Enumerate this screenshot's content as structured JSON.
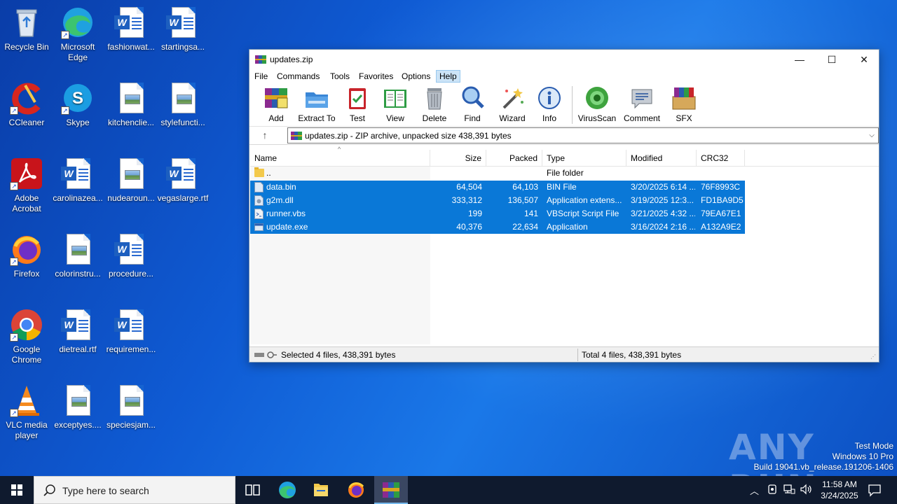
{
  "desktop": {
    "icons": [
      {
        "label": "Recycle Bin"
      },
      {
        "label": "Microsoft Edge"
      },
      {
        "label": "fashionwat..."
      },
      {
        "label": "startingsa..."
      },
      {
        "label": "CCleaner"
      },
      {
        "label": "Skype"
      },
      {
        "label": "kitchenclie..."
      },
      {
        "label": "stylefuncti..."
      },
      {
        "label": "Adobe Acrobat"
      },
      {
        "label": "carolinazea..."
      },
      {
        "label": "nudearoun..."
      },
      {
        "label": "vegaslarge.rtf"
      },
      {
        "label": "Firefox"
      },
      {
        "label": "colorinstru..."
      },
      {
        "label": "procedure..."
      },
      {
        "label": "Google Chrome"
      },
      {
        "label": "dietreal.rtf"
      },
      {
        "label": "requiremen..."
      },
      {
        "label": "VLC media player"
      },
      {
        "label": "exceptyes...."
      },
      {
        "label": "speciesjam..."
      }
    ]
  },
  "window": {
    "title": "updates.zip",
    "controls": {
      "minimize": "—",
      "maximize": "☐",
      "close": "✕"
    },
    "menu": [
      "File",
      "Commands",
      "Tools",
      "Favorites",
      "Options",
      "Help"
    ],
    "toolbar": [
      "Add",
      "Extract To",
      "Test",
      "View",
      "Delete",
      "Find",
      "Wizard",
      "Info",
      "VirusScan",
      "Comment",
      "SFX"
    ],
    "address": "updates.zip - ZIP archive, unpacked size 438,391 bytes",
    "columns": [
      "Name",
      "Size",
      "Packed",
      "Type",
      "Modified",
      "CRC32"
    ],
    "rows": [
      {
        "name": "..",
        "size": "",
        "packed": "",
        "type": "File folder",
        "modified": "",
        "crc": "",
        "icon": "folder-icon",
        "selected": false
      },
      {
        "name": "data.bin",
        "size": "64,504",
        "packed": "64,103",
        "type": "BIN File",
        "modified": "3/20/2025 6:14 ...",
        "crc": "76F8993C",
        "icon": "file-icon",
        "selected": true
      },
      {
        "name": "g2m.dll",
        "size": "333,312",
        "packed": "136,507",
        "type": "Application extens...",
        "modified": "3/19/2025 12:3...",
        "crc": "FD1BA9D5",
        "icon": "dll-icon",
        "selected": true
      },
      {
        "name": "runner.vbs",
        "size": "199",
        "packed": "141",
        "type": "VBScript Script File",
        "modified": "3/21/2025 4:32 ...",
        "crc": "79EA67E1",
        "icon": "script-icon",
        "selected": true
      },
      {
        "name": "update.exe",
        "size": "40,376",
        "packed": "22,634",
        "type": "Application",
        "modified": "3/16/2024 2:16 ...",
        "crc": "A132A9E2",
        "icon": "exe-icon",
        "selected": true
      }
    ],
    "status_left": "Selected 4 files, 438,391 bytes",
    "status_right": "Total 4 files, 438,391 bytes"
  },
  "taskbar": {
    "search_placeholder": "Type here to search",
    "time": "11:58 AM",
    "date": "3/24/2025"
  },
  "watermark": {
    "brand": "ANY RUN",
    "line1": "Test Mode",
    "line2": "Windows 10 Pro",
    "line3": "Build 19041.vb_release.191206-1406"
  },
  "colors": {
    "selection": "#0a78d7",
    "taskbar": "#0f1a2e",
    "desktop": "#0f5bd4"
  }
}
